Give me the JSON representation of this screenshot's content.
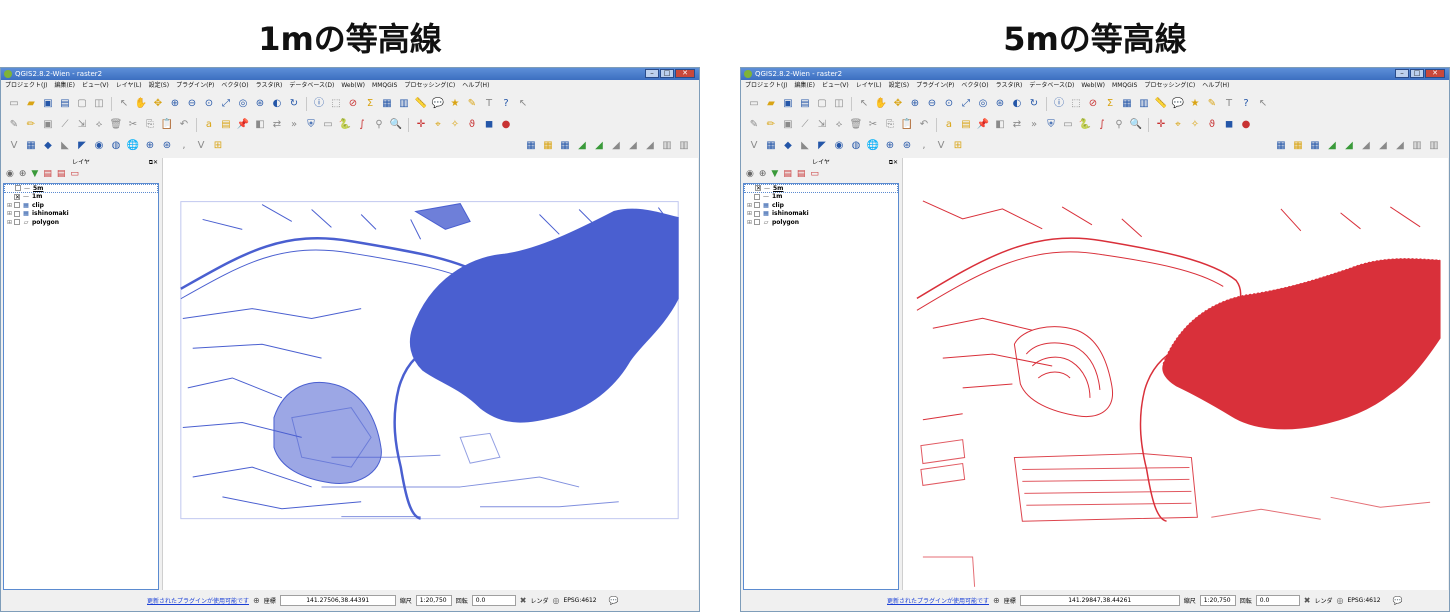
{
  "headings": {
    "left": "1mの等高線",
    "right": "5mの等高線"
  },
  "window": {
    "title": "QGIS2.8.2-Wien - raster2",
    "controls": {
      "minimize": "–",
      "maximize": "□",
      "close": "✕"
    }
  },
  "menu": [
    "プロジェクト(J)",
    "編集(E)",
    "ビュー(V)",
    "レイヤ(L)",
    "設定(S)",
    "プラグイン(P)",
    "ベクタ(O)",
    "ラスタ(R)",
    "データベース(D)",
    "Web(W)",
    "MMQGIS",
    "プロセッシング(C)",
    "ヘルプ(H)"
  ],
  "layers_panel": {
    "title": "レイヤ",
    "controls": "⧉✕"
  },
  "left_window": {
    "layers": [
      {
        "name": "5m",
        "checked": false,
        "symbol": "—",
        "expander": ""
      },
      {
        "name": "1m",
        "checked": true,
        "symbol": "—",
        "expander": ""
      },
      {
        "name": "clip",
        "checked": false,
        "symbol": "▦",
        "expander": "⊞"
      },
      {
        "name": "ishinomaki",
        "checked": false,
        "symbol": "▦",
        "expander": "⊞"
      },
      {
        "name": "polygon",
        "checked": false,
        "symbol": "▱",
        "expander": "⊞"
      }
    ],
    "contour_color": "#4a5fd0",
    "status": {
      "plugin_notice": "更新されたプラグインが使用可能です",
      "coord_label": "座標",
      "coordinate": "141.27506,38.44391",
      "scale_label": "縮尺",
      "scale": "1:20,750",
      "rotation_label": "回転",
      "rotation": "0.0",
      "render_label": "レンダ",
      "crs": "EPSG:4612"
    }
  },
  "right_window": {
    "layers": [
      {
        "name": "5m",
        "checked": true,
        "symbol": "—",
        "expander": ""
      },
      {
        "name": "1m",
        "checked": false,
        "symbol": "—",
        "expander": ""
      },
      {
        "name": "clip",
        "checked": false,
        "symbol": "▦",
        "expander": "⊞"
      },
      {
        "name": "ishinomaki",
        "checked": false,
        "symbol": "▦",
        "expander": "⊞"
      },
      {
        "name": "polygon",
        "checked": false,
        "symbol": "▱",
        "expander": "⊞"
      }
    ],
    "contour_color": "#d9303a",
    "status": {
      "plugin_notice": "更新されたプラグインが使用可能です",
      "coord_label": "座標",
      "coordinate": "141.29847,38.44261",
      "scale_label": "縮尺",
      "scale": "1:20,750",
      "rotation_label": "回転",
      "rotation": "0.0",
      "render_label": "レンダ",
      "crs": "EPSG:4612"
    }
  }
}
